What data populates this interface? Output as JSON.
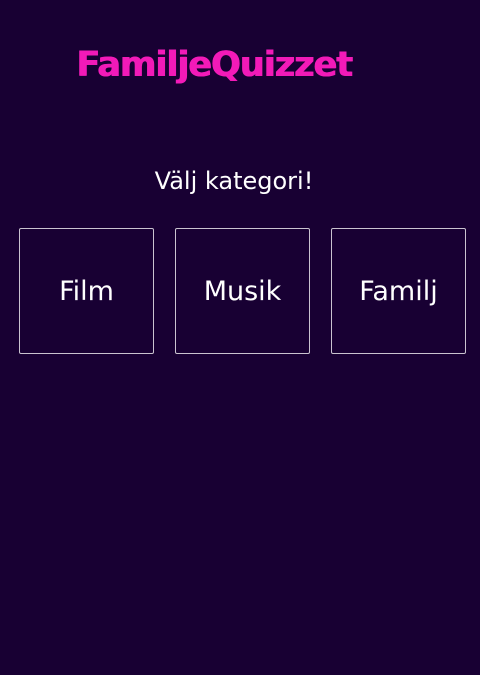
{
  "app": {
    "title": "FamiljeQuizzet",
    "brand_color": "#f21ab8",
    "background_color": "#180033"
  },
  "main": {
    "prompt": "Välj kategori!",
    "categories": [
      {
        "label": "Film"
      },
      {
        "label": "Musik"
      },
      {
        "label": "Familj"
      }
    ]
  }
}
